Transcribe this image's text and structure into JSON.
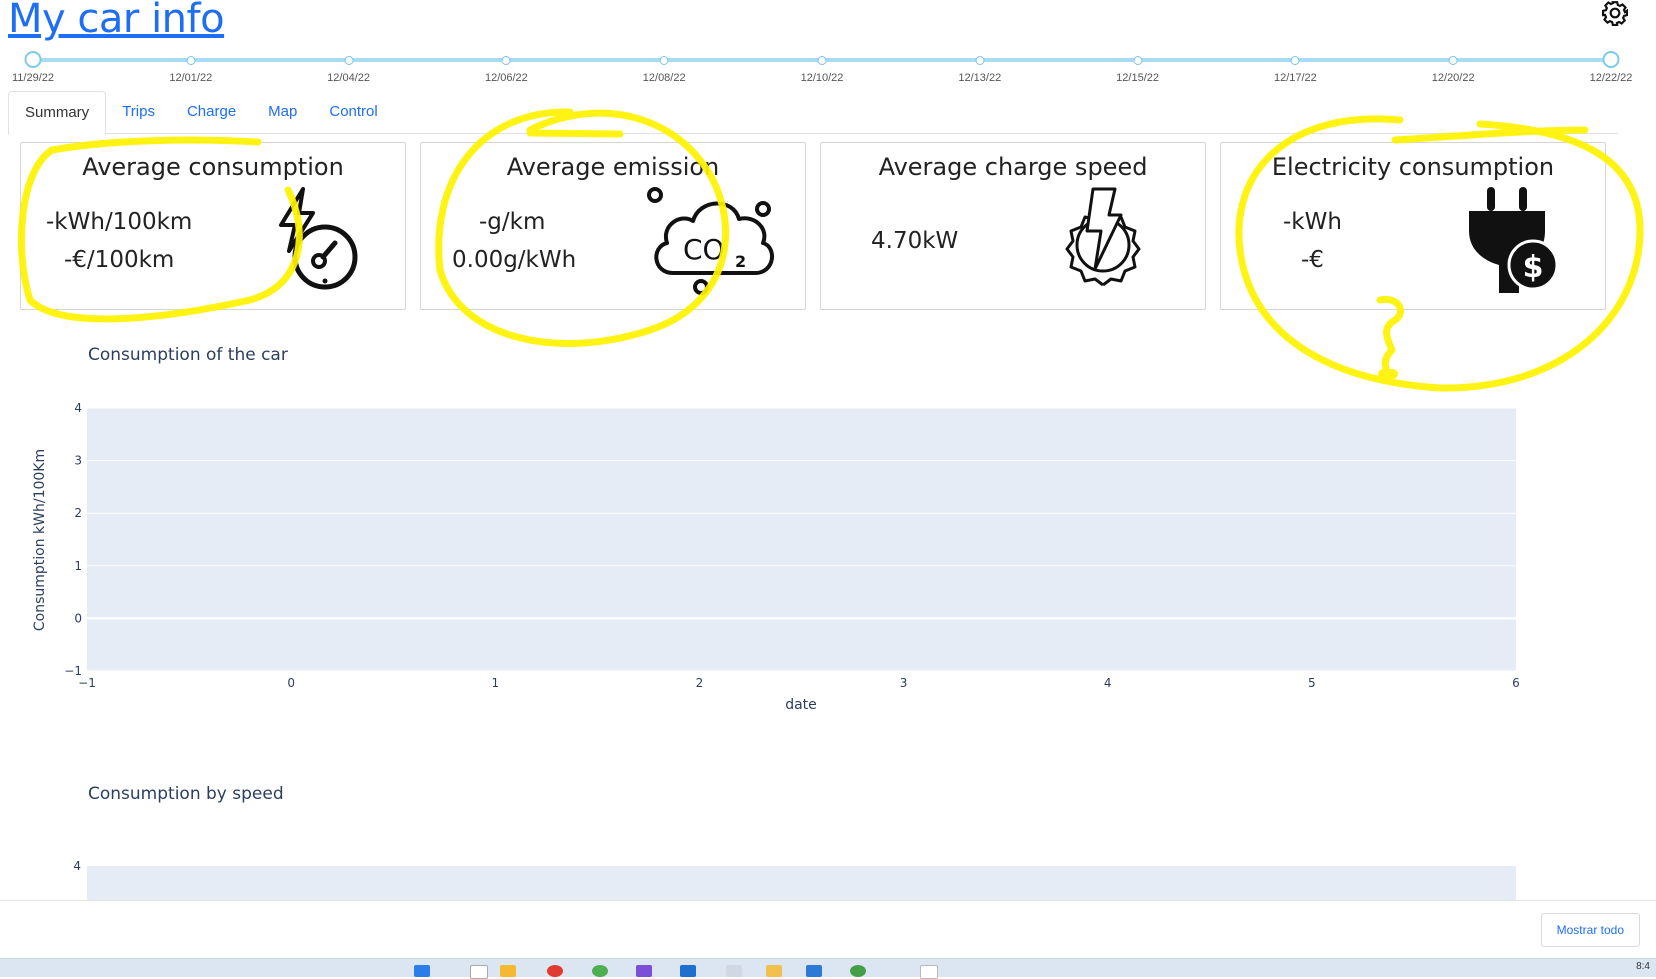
{
  "app": {
    "title": "My car info"
  },
  "slider": {
    "marks": [
      "11/29/22",
      "12/01/22",
      "12/04/22",
      "12/06/22",
      "12/08/22",
      "12/10/22",
      "12/13/22",
      "12/15/22",
      "12/17/22",
      "12/20/22",
      "12/22/22"
    ],
    "range_start": "11/29/22",
    "range_end": "12/22/22"
  },
  "tabs": [
    {
      "label": "Summary",
      "active": true
    },
    {
      "label": "Trips"
    },
    {
      "label": "Charge"
    },
    {
      "label": "Map"
    },
    {
      "label": "Control"
    }
  ],
  "cards": {
    "consumption": {
      "title": "Average consumption",
      "line1": "-kWh/100km",
      "line2": "-€/100km",
      "icon": "speedometer-lightning-icon"
    },
    "emission": {
      "title": "Average emission",
      "line1": "-g/km",
      "line2": "0.00g/kWh",
      "icon": "co2-cloud-icon"
    },
    "charge_speed": {
      "title": "Average charge speed",
      "line1": "4.70kW",
      "icon": "gear-lightning-icon"
    },
    "electricity": {
      "title": "Electricity consumption",
      "line1": "-kWh",
      "line2": "-€",
      "icon": "plug-dollar-icon"
    }
  },
  "charts": {
    "car": {
      "title": "Consumption of the car"
    },
    "speed": {
      "title": "Consumption by speed"
    }
  },
  "chart_data": [
    {
      "type": "line",
      "title": "Consumption of the car",
      "xlabel": "date",
      "ylabel": "Consumption kWh/100Km",
      "xlim": [
        -1,
        6
      ],
      "ylim": [
        -1,
        4
      ],
      "x_ticks": [
        "−1",
        "0",
        "1",
        "2",
        "3",
        "4",
        "5",
        "6"
      ],
      "y_ticks": [
        "−1",
        "0",
        "1",
        "2",
        "3",
        "4"
      ],
      "series": []
    },
    {
      "type": "line",
      "title": "Consumption by speed",
      "ylim_visible_top": 4,
      "y_ticks": [
        "4"
      ],
      "series": []
    }
  ],
  "footer": {
    "show_all_label": "Mostrar todo"
  },
  "taskbar": {
    "clock": "8:4"
  },
  "colors": {
    "accent": "#1d6ef5",
    "plot_bg": "#e5ecf6",
    "slider": "#a7dcf2",
    "highlighter": "#fff200"
  }
}
